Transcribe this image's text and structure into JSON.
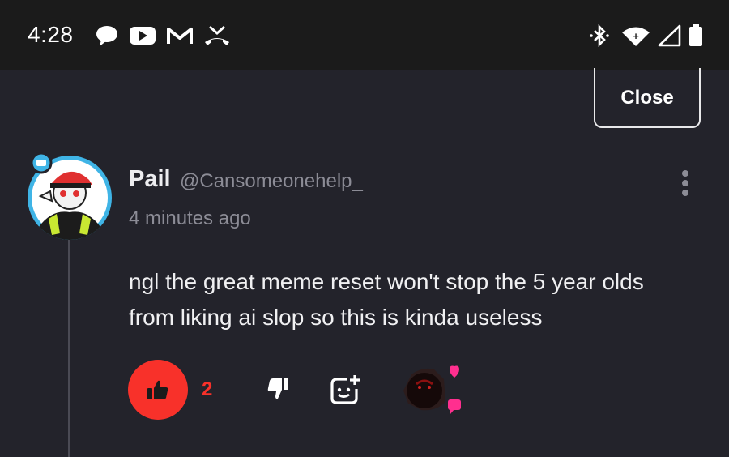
{
  "status_bar": {
    "time": "4:28",
    "left_icons": [
      "chat-bubble-icon",
      "youtube-icon",
      "gmail-icon",
      "missed-call-icon"
    ],
    "right_icons": [
      "bluetooth-icon",
      "wifi-icon",
      "signal-icon",
      "battery-icon"
    ]
  },
  "close_label": "Close",
  "comment": {
    "author_name": "Pail",
    "author_handle": "@Cansomeonehelp_",
    "time_ago": "4 minutes ago",
    "text": "ngl the great meme reset won't stop the 5 year olds from liking ai slop so this is kinda useless",
    "like_count": "2"
  },
  "colors": {
    "background": "#23232b",
    "status_bar": "#1b1b1b",
    "like_red": "#f8312a",
    "avatar_ring": "#3fb4e6",
    "reaction_pink": "#ff2f8f"
  }
}
